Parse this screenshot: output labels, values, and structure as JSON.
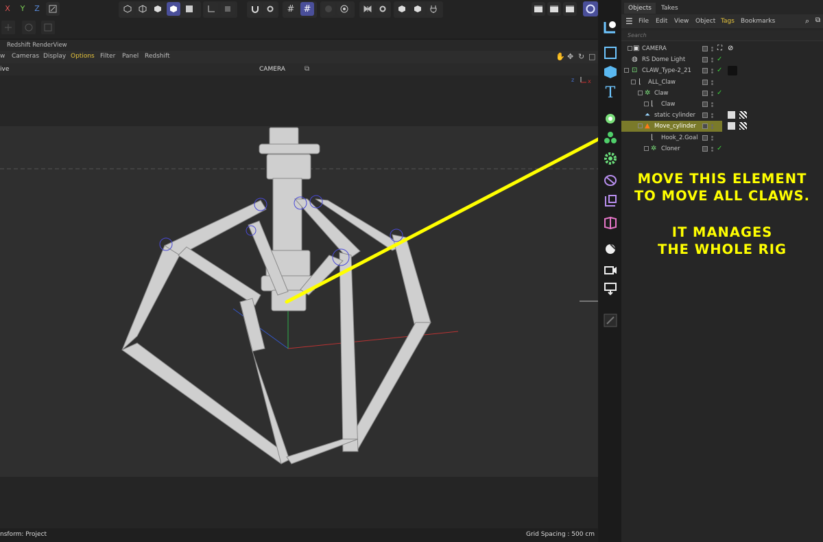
{
  "toolbar": {
    "axes": [
      "X",
      "Y",
      "Z"
    ]
  },
  "viewport": {
    "title": "Redshift RenderView",
    "menu": [
      "w",
      "Cameras",
      "Display",
      "Options",
      "Filter",
      "Panel",
      "Redshift"
    ],
    "active_menu": "Options",
    "view_label": "ive",
    "camera_label": "CAMERA",
    "axis_z": "z",
    "axis_x": "x",
    "status_left": "nsform: Project",
    "grid_spacing": "Grid Spacing : 500 cm"
  },
  "object_manager": {
    "tabs": [
      "Objects",
      "Takes"
    ],
    "menu": [
      "File",
      "Edit",
      "View",
      "Object",
      "Tags",
      "Bookmarks"
    ],
    "active_menu": "Tags",
    "search_placeholder": "Search",
    "rows": [
      {
        "name": "CAMERA",
        "icon": "camera-icon",
        "highlighted": false,
        "checked": false
      },
      {
        "name": "RS Dome Light",
        "icon": "dome-light-icon",
        "highlighted": false,
        "checked": true
      },
      {
        "name": "CLAW_Type-2_21",
        "icon": "null-object-icon",
        "highlighted": false,
        "checked": true
      },
      {
        "name": "ALL_Claw",
        "icon": "null-object-icon",
        "highlighted": false,
        "checked": false
      },
      {
        "name": "Claw",
        "icon": "cloner-icon",
        "highlighted": false,
        "checked": true
      },
      {
        "name": "Claw",
        "icon": "null-object-icon",
        "highlighted": false,
        "checked": false
      },
      {
        "name": "static cylinder",
        "icon": "joint-icon",
        "highlighted": false,
        "checked": false
      },
      {
        "name": "Move_cylinder",
        "icon": "joint-icon",
        "highlighted": true,
        "checked": false
      },
      {
        "name": "Hook_2.Goal",
        "icon": "null-object-icon",
        "highlighted": false,
        "checked": false
      },
      {
        "name": "Cloner",
        "icon": "cloner-icon",
        "highlighted": false,
        "checked": true
      }
    ]
  },
  "annotation": {
    "line1": "MOVE THIS ELEMENT",
    "line2": "TO MOVE ALL CLAWS.",
    "line3": "IT MANAGES",
    "line4": "THE WHOLE RIG",
    "color": "#ffff00"
  },
  "colors": {
    "accent": "#4a4f9a",
    "highlight_row": "#7a7a2a",
    "check": "#3ad13a"
  }
}
